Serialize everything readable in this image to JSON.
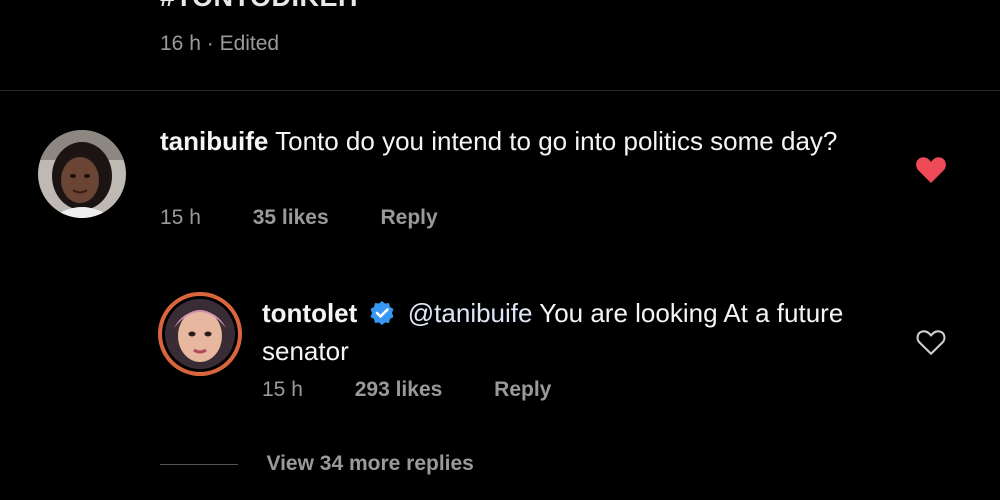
{
  "post": {
    "caption_tail": "#TONTODIKEH",
    "time": "16 h",
    "separator": "·",
    "edited": "Edited"
  },
  "comment": {
    "username": "tanibuife",
    "text": "Tonto do you intend to go into politics some day?",
    "time": "15 h",
    "likes": "35 likes",
    "reply_label": "Reply",
    "liked": true,
    "heart_color": "#ed4956"
  },
  "reply": {
    "username": "tontolet",
    "verified": true,
    "mention": "@tanibuife",
    "text": "You are looking At a future senator",
    "time": "15 h",
    "likes": "293 likes",
    "reply_label": "Reply",
    "liked": false,
    "verified_color": "#3897f0"
  },
  "view_more_replies": "View 34 more replies",
  "colors": {
    "background": "#000000",
    "text": "#f5f5f5",
    "muted": "#9a9a9a"
  }
}
